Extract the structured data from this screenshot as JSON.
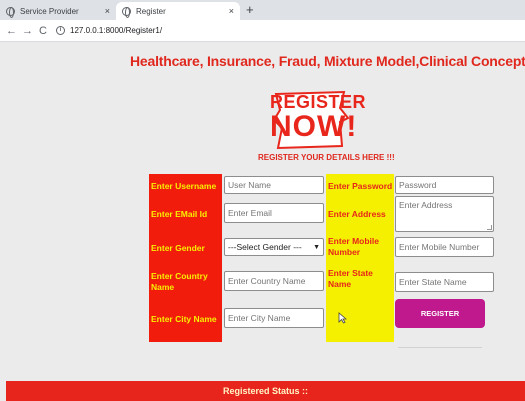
{
  "browser": {
    "tabs": [
      {
        "label": "Service Provider",
        "close": "×"
      },
      {
        "label": "Register",
        "close": "×"
      }
    ],
    "new_tab": "+",
    "back": "←",
    "forward": "→",
    "reload": "C",
    "url": "127.0.0.1:8000/Register1/"
  },
  "page": {
    "title": "Healthcare, Insurance, Fraud, Mixture Model,Clinical Concepts.",
    "logo": {
      "line1": "REGISTER",
      "line2": "NOW!"
    },
    "subheading": "REGISTER YOUR DETAILS HERE !!!",
    "form": {
      "username": {
        "label": "Enter Username",
        "placeholder": "User Name"
      },
      "email": {
        "label": "Enter EMail Id",
        "placeholder": "Enter Email"
      },
      "gender": {
        "label": "Enter Gender",
        "selected": "---Select Gender ---"
      },
      "country": {
        "label": "Enter Country Name",
        "placeholder": "Enter Country Name"
      },
      "city": {
        "label": "Enter City Name",
        "placeholder": "Enter City Name"
      },
      "password": {
        "label": "Enter Password",
        "placeholder": "Password"
      },
      "address": {
        "label": "Enter Address",
        "placeholder": "Enter Address"
      },
      "mobile": {
        "label": "Enter Mobile Number",
        "placeholder": "Enter Mobile Number"
      },
      "state": {
        "label": "Enter State Name",
        "placeholder": "Enter State Name"
      },
      "submit": "REGISTER"
    },
    "status_bar": "Registered Status ::"
  },
  "colors": {
    "accent_red": "#e0281e",
    "label_red_bg": "#f21c0c",
    "label_yellow_bg": "#f5f000",
    "button_magenta": "#c0198d"
  }
}
